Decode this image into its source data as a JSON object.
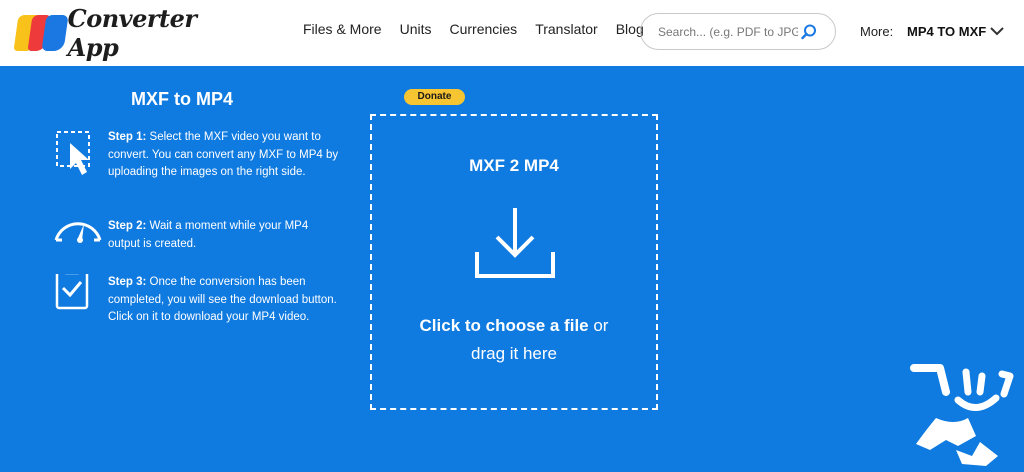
{
  "header": {
    "logo_text": "Converter App",
    "nav": [
      "Files & More",
      "Units",
      "Currencies",
      "Translator",
      "Blog"
    ],
    "search_placeholder": "Search... (e.g. PDF to JPG)",
    "more_label": "More:",
    "more_value": "MP4 TO MXF"
  },
  "left": {
    "title": "MXF to MP4",
    "steps": [
      {
        "label": "Step 1:",
        "text": " Select the MXF video you want to convert. You can convert any MXF to MP4 by uploading the images on the right side.",
        "icon": "cursor-select-icon"
      },
      {
        "label": "Step 2:",
        "text": " Wait a moment while your MP4 output is created.",
        "icon": "speedometer-icon"
      },
      {
        "label": "Step 3:",
        "text": " Once the conversion has been completed, you will see the download button. Click on it to download your MP4 video.",
        "icon": "clipboard-check-icon"
      }
    ]
  },
  "donate_label": "Donate",
  "dropzone": {
    "title": "MXF 2 MP4",
    "choose": "Click to choose a file",
    "or": " or",
    "drag": "drag it here"
  },
  "colors": {
    "background": "#0f7ae0",
    "donate": "#f7c532",
    "header": "#ffffff"
  }
}
